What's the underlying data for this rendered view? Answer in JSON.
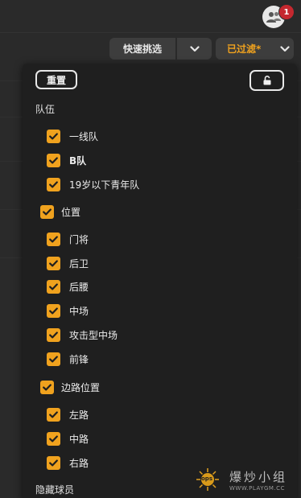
{
  "header": {
    "notification_count": "1",
    "quick_filter_label": "快速挑选",
    "filtered_label": "已过滤*"
  },
  "dropdown": {
    "reset_label": "重置",
    "sections": [
      {
        "title": "队伍",
        "items": [
          "一线队",
          "B队",
          "19岁以下青年队"
        ]
      },
      {
        "title": "位置",
        "items": [
          "门将",
          "后卫",
          "后腰",
          "中场",
          "攻击型中场",
          "前锋"
        ]
      },
      {
        "title": "边路位置",
        "items": [
          "左路",
          "中路",
          "右路"
        ]
      },
      {
        "title": "隐藏球员",
        "items": []
      }
    ]
  },
  "watermark": {
    "name": "爆炒小组",
    "url": "WWW.PLAYGM.CC",
    "logo_text": "ops"
  },
  "colors": {
    "accent": "#f0a21e",
    "badge": "#c5282f",
    "panel": "#1f1f1f",
    "background": "#2a2a2a"
  },
  "icons": {
    "avatar": "users-icon",
    "chevron": "chevron-down-icon",
    "lock": "unlock-icon",
    "check": "checkmark-icon"
  }
}
